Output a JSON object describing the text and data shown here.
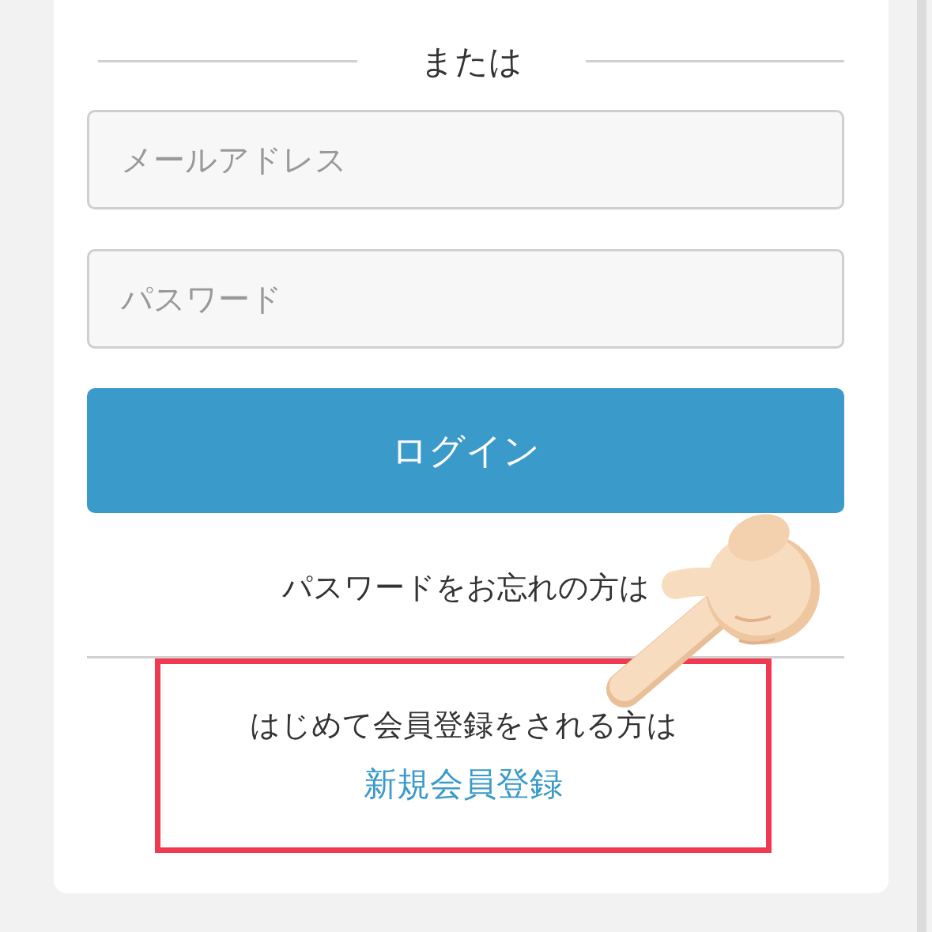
{
  "divider_label": "または",
  "email_field": {
    "placeholder": "メールアドレス"
  },
  "password_field": {
    "placeholder": "パスワード"
  },
  "login_button": "ログイン",
  "forgot_password_text": "パスワードをお忘れの方は",
  "register": {
    "prompt": "はじめて会員登録をされる方は",
    "link": "新規会員登録",
    "highlighted": true
  },
  "pointer": {
    "kind": "hand"
  }
}
